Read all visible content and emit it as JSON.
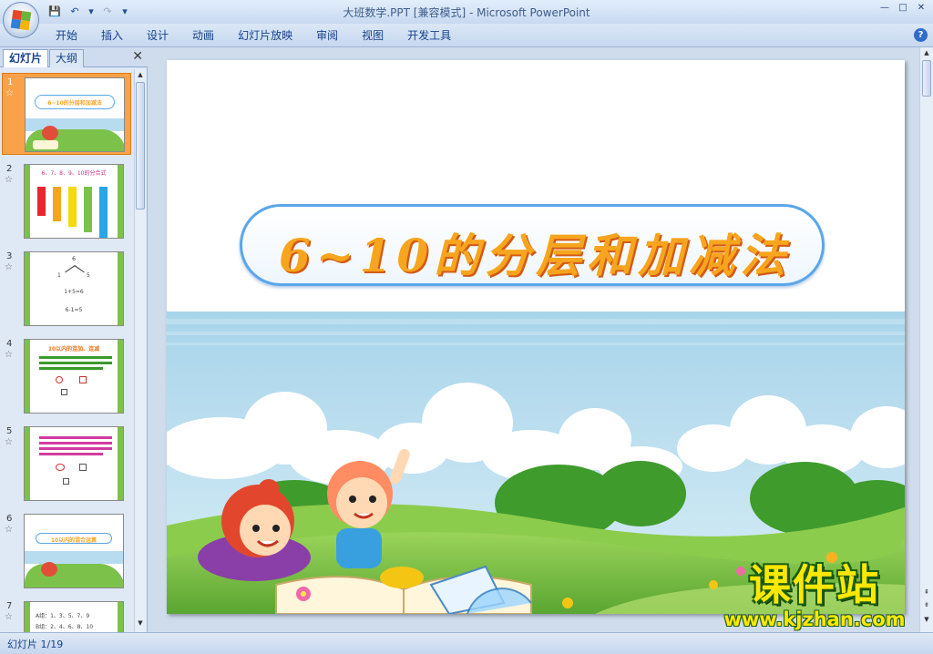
{
  "window": {
    "title": "大班数学.PPT [兼容模式] - Microsoft PowerPoint",
    "controls": [
      "—",
      "□",
      "✕"
    ]
  },
  "quick_access": {
    "icons": [
      "save-icon",
      "undo-icon",
      "undo-dropdown-icon",
      "redo-icon",
      "customize-dropdown-icon"
    ]
  },
  "menu": {
    "tabs": [
      "开始",
      "插入",
      "设计",
      "动画",
      "幻灯片放映",
      "审阅",
      "视图",
      "开发工具"
    ]
  },
  "panel": {
    "tab_slides": "幻灯片",
    "tab_outline": "大纲"
  },
  "slides": [
    {
      "num": "1",
      "caption": "6~10的分层和加减法"
    },
    {
      "num": "2",
      "caption": "6、7、8、9、10的分合式"
    },
    {
      "num": "3",
      "tree_top": "6",
      "tree_left": "1",
      "tree_right": "5",
      "eq1": "1+5=6",
      "eq2": "6-1=5"
    },
    {
      "num": "4",
      "caption": "10以内的连加、连减"
    },
    {
      "num": "5"
    },
    {
      "num": "6",
      "caption": "10以内的混合运算"
    },
    {
      "num": "7",
      "line1": "A组：1、3、5、7、9",
      "line2": "B组：2、4、6、8、10"
    }
  ],
  "main_slide": {
    "title": "6~10的分层和加减法"
  },
  "watermark": {
    "main": "课件站",
    "url": "www.kjzhan.com"
  },
  "status": {
    "text": "幻灯片 1/19"
  },
  "colors": {
    "accent_orange": "#f7a51e",
    "pill_border": "#5aa6ea",
    "sky": "#a8d4ea",
    "grass": "#7cc24a"
  }
}
